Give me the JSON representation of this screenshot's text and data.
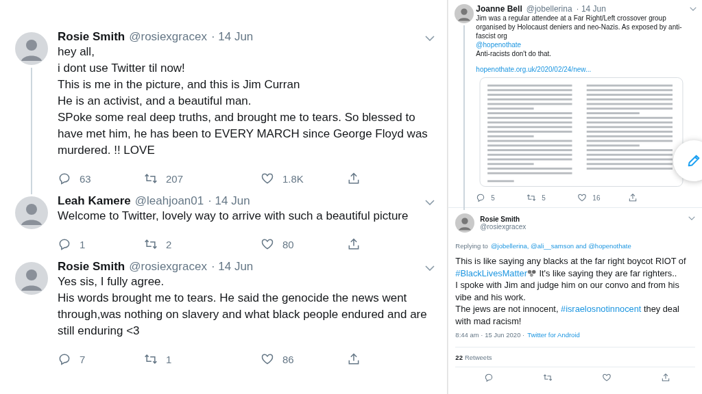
{
  "left_panel": {
    "tweets": [
      {
        "name": "Rosie Smith",
        "handle": "@rosiexgracex",
        "date": "· 14 Jun",
        "thread_line": true,
        "body": [
          "hey all,",
          "i dont use Twitter til now!",
          "This is me in the picture, and this is Jim Curran",
          "He is an activist, and a beautiful man.",
          "SPoke some real deep truths, and brought me to tears. So blessed to have met him, he has been to EVERY MARCH since George Floyd was murdered. !! LOVE"
        ],
        "actions": [
          {
            "kind": "reply",
            "count": "63"
          },
          {
            "kind": "retweet",
            "count": "207"
          },
          {
            "kind": "like",
            "count": "1.8K"
          },
          {
            "kind": "share"
          }
        ]
      },
      {
        "name": "Leah Kamere",
        "handle": "@leahjoan01",
        "date": "· 14 Jun",
        "thread_line": false,
        "body": [
          "Welcome to Twitter, lovely way to arrive with such a beautiful picture"
        ],
        "actions": [
          {
            "kind": "reply",
            "count": "1"
          },
          {
            "kind": "retweet",
            "count": "2"
          },
          {
            "kind": "like",
            "count": "80"
          },
          {
            "kind": "share"
          }
        ]
      },
      {
        "name": "Rosie Smith",
        "handle": "@rosiexgracex",
        "date": "· 14 Jun",
        "thread_line": false,
        "body": [
          "Yes sis, I fully agree.",
          "His words brought me to tears. He said the genocide the news went through,was nothing on slavery and what black people endured and are still enduring <3"
        ],
        "actions": [
          {
            "kind": "reply",
            "count": "7"
          },
          {
            "kind": "retweet",
            "count": "1"
          },
          {
            "kind": "like",
            "count": "86"
          },
          {
            "kind": "share"
          }
        ]
      }
    ]
  },
  "right_panel": {
    "tweet": {
      "name": "Joanne Bell",
      "handle": "@jobellerina",
      "date": "· 14 Jun",
      "body": [
        {
          "kind": "text",
          "text": "Jim was a regular attendee at a Far Right/Left crossover group organised by Holocaust deniers and neo-Nazis. As exposed by anti-fascist org"
        },
        {
          "kind": "mention",
          "text": "@hopenothate"
        },
        {
          "kind": "text",
          "text": "Anti-racists don't do that."
        },
        {
          "kind": "link",
          "text": "hopenothate.org.uk/2020/02/24/new..."
        }
      ],
      "actions": [
        {
          "kind": "reply",
          "count": "5"
        },
        {
          "kind": "retweet",
          "count": "5"
        },
        {
          "kind": "like",
          "count": "16"
        },
        {
          "kind": "share"
        }
      ]
    },
    "detail": {
      "name": "Rosie Smith",
      "handle": "@rosiexgracex",
      "replying_label": "Replying to",
      "replying_to": "@jobellerina, @ali__samson and @hopenothate",
      "body": [
        {
          "kind": "text",
          "text": "This is like saying any blacks at the far right boycot RIOT of "
        },
        {
          "kind": "hashtag",
          "text": "#BlackLivesMatter"
        },
        {
          "kind": "emoji"
        },
        {
          "kind": "text",
          "text": " It's like saying they are far righters.."
        },
        {
          "kind": "break"
        },
        {
          "kind": "text",
          "text": "I spoke with Jim and judge him on our convo and from his vibe and his work."
        },
        {
          "kind": "break"
        },
        {
          "kind": "text",
          "text": "The jews are not innocent, "
        },
        {
          "kind": "hashtag",
          "text": "#israelosnotinnocent"
        },
        {
          "kind": "text",
          "text": " they deal with mad racism!"
        }
      ],
      "timestamp": "8:44 am · 15 Jun 2020 ·",
      "source": "Twitter for Android",
      "retweet_count": "22",
      "retweet_label": "Retweets",
      "actions": [
        {
          "kind": "reply"
        },
        {
          "kind": "retweet"
        },
        {
          "kind": "like"
        },
        {
          "kind": "share"
        }
      ]
    }
  }
}
